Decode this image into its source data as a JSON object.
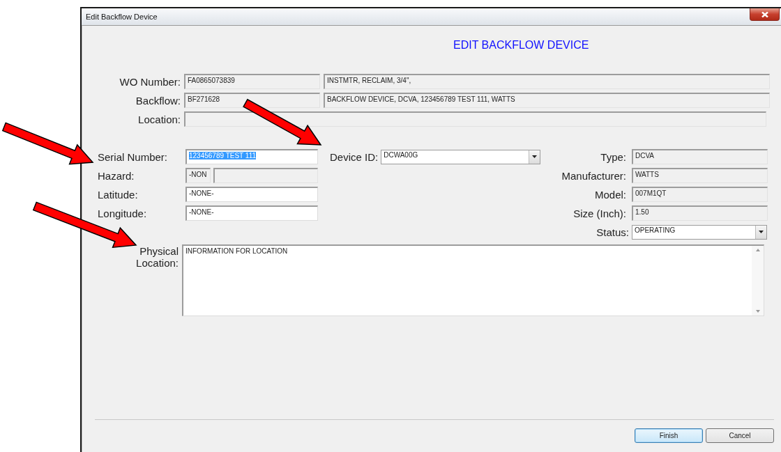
{
  "window": {
    "title": "Edit Backflow Device"
  },
  "heading": "EDIT BACKFLOW DEVICE",
  "header_fields": [
    {
      "label": "WO Number:",
      "value": "FA0865073839",
      "description": "INSTMTR, RECLAIM, 3/4\","
    },
    {
      "label": "Backflow:",
      "value": "BF271628",
      "description": "BACKFLOW DEVICE, DCVA, 123456789 TEST 111, WATTS"
    },
    {
      "label": "Location:"
    }
  ],
  "serial_number": {
    "label": "Serial Number:",
    "value": "123456789 TEST 111",
    "selected": true
  },
  "device_id": {
    "label": "Device ID:",
    "value": "DCWA00G"
  },
  "hazard": {
    "label": "Hazard:",
    "code": "-NON"
  },
  "latitude": {
    "label": "Latitude:",
    "value": "-NONE-"
  },
  "longitude": {
    "label": "Longitude:",
    "value": "-NONE-"
  },
  "device_info": [
    {
      "label": "Type:",
      "value": "DCVA"
    },
    {
      "label": "Manufacturer:",
      "value": "WATTS"
    },
    {
      "label": "Model:",
      "value": "007M1QT"
    },
    {
      "label": "Size (Inch):",
      "value": "1.50"
    }
  ],
  "status": {
    "label": "Status:",
    "value": "OPERATING"
  },
  "physical_location": {
    "label": "Physical Location:",
    "value": "INFORMATION FOR LOCATION"
  },
  "buttons": [
    {
      "label": "Finish",
      "default": true
    },
    {
      "label": "Cancel",
      "default": false
    }
  ]
}
